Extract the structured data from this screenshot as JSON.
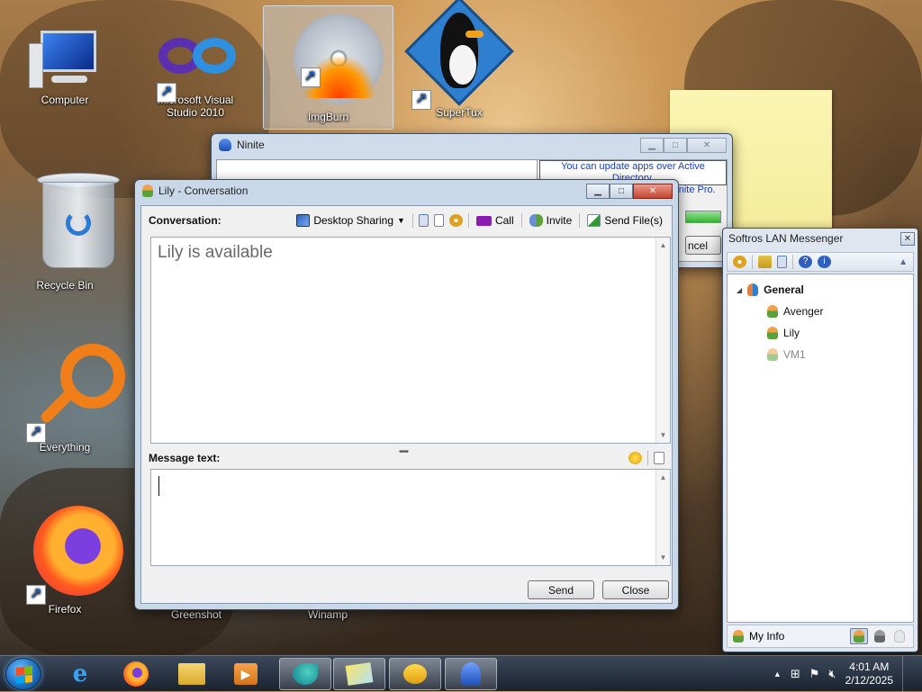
{
  "desktop": {
    "icons": [
      {
        "label": "Computer"
      },
      {
        "label": "Microsoft Visual Studio 2010"
      },
      {
        "label": "ImgBurn"
      },
      {
        "label": "SuperTux"
      },
      {
        "label": "Recycle Bin"
      },
      {
        "label": "Everything"
      },
      {
        "label": "Firefox"
      },
      {
        "label": "Greenshot"
      },
      {
        "label": "Winamp"
      }
    ]
  },
  "ninite": {
    "title": "Ninite",
    "ad_line1": "You can update apps over Active Directory.",
    "ad_line2": "Click here for a free trial of Ninite Pro.",
    "cancel_label": "ncel"
  },
  "conversation": {
    "title": "Lily - Conversation",
    "conversation_label": "Conversation:",
    "tools": {
      "desktop_sharing": "Desktop Sharing",
      "call": "Call",
      "invite": "Invite",
      "send_files": "Send File(s)"
    },
    "status_text": "Lily is available",
    "message_label": "Message text:",
    "message_value": "",
    "send_label": "Send",
    "close_label": "Close"
  },
  "messenger": {
    "title": "Softros LAN Messenger",
    "group": "General",
    "users": [
      {
        "name": "Avenger",
        "online": true
      },
      {
        "name": "Lily",
        "online": true
      },
      {
        "name": "VM1",
        "online": false
      }
    ],
    "my_info": "My Info"
  },
  "taskbar": {
    "time": "4:01 AM",
    "date": "2/12/2025"
  },
  "colors": {
    "ad_link": "#1a3fbf",
    "call_icon": "#8a1db0",
    "accent": "#1d6fc2"
  }
}
